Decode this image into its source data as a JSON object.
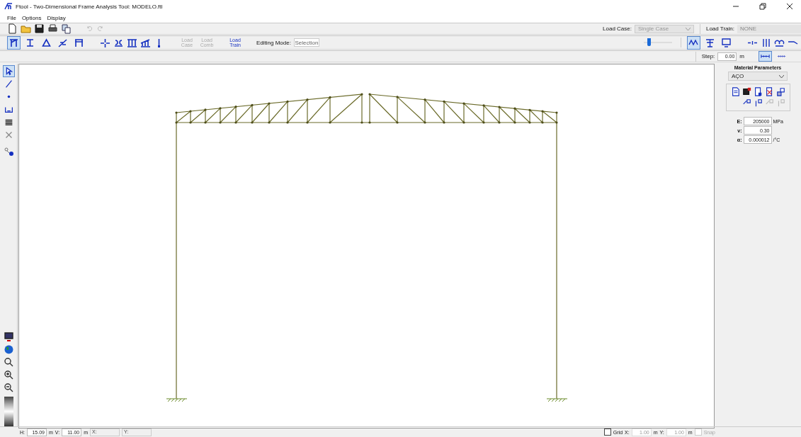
{
  "window": {
    "title": "Ftool - Two-Dimensional Frame Analysis Tool: MODELO.ftl"
  },
  "menu": [
    "File",
    "Options",
    "Display"
  ],
  "mode_tools": [
    {
      "selected": true
    },
    {
      "selected": false
    },
    {
      "selected": false
    },
    {
      "selected": false
    },
    {
      "selected": false
    }
  ],
  "load_buttons": [
    {
      "label": "Load Case",
      "disabled": true
    },
    {
      "label": "Load Comb",
      "disabled": true
    },
    {
      "label": "Load Train",
      "disabled": false
    }
  ],
  "editing_mode": {
    "label": "Editing Mode:",
    "value": "Selection"
  },
  "load_case": {
    "label": "Load Case:",
    "value": "Single Case",
    "disabled": true
  },
  "load_train": {
    "label": "Load Train:",
    "value": "NONE",
    "disabled": true
  },
  "zoom_slider": {
    "level": 0.12
  },
  "view_tools": [
    {
      "selected": true
    },
    {
      "selected": false
    },
    {
      "selected": false
    }
  ],
  "step": {
    "label": "Step:",
    "value": "0.00",
    "unit": "m"
  },
  "step_tools": [
    {
      "selected": true
    },
    {
      "selected": false
    }
  ],
  "side_tools": [
    {
      "selected": true
    },
    {
      "selected": false
    },
    {
      "selected": false
    },
    {
      "selected": false
    },
    {
      "selected": false
    },
    {
      "selected": false
    }
  ],
  "material": {
    "title": "Material Parameters",
    "value": "AÇO",
    "params": [
      {
        "label": "E:",
        "value": "205000",
        "unit": "MPa"
      },
      {
        "label": "ν:",
        "value": "0.30"
      },
      {
        "label": "α:",
        "value": "0.000012",
        "unit": "/°C"
      }
    ]
  },
  "status_bar": {
    "h_label": "H:",
    "h_value": "15.09",
    "h_unit": "m",
    "v_label": "V:",
    "v_value": "11.00",
    "v_unit": "m",
    "x_label": "X:",
    "y_label": "Y:",
    "grid": {
      "label": "Grid",
      "checked": false
    },
    "gx_label": "X:",
    "gx_value": "1.00",
    "gx_unit": "m",
    "gy_label": "Y:",
    "gy_value": "1.00",
    "gy_unit": "m",
    "snap": {
      "label": "Snap",
      "checked": false,
      "disabled": true
    }
  }
}
